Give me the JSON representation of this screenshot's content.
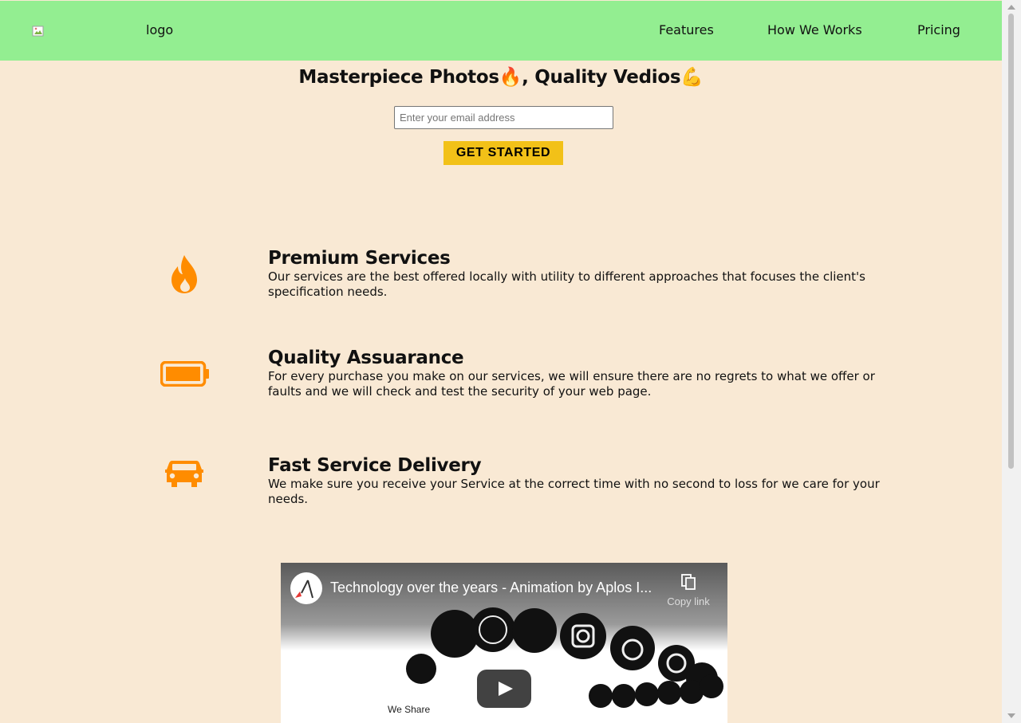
{
  "nav": {
    "logo_alt": "logo",
    "links": [
      "Features",
      "How We Works",
      "Pricing"
    ]
  },
  "hero": {
    "title": "Masterpiece Photos🔥, Quality Vedios💪",
    "email_placeholder": "Enter your email address",
    "cta_label": "GET STARTED"
  },
  "features": [
    {
      "icon": "fire-icon",
      "title": "Premium Services",
      "desc": "Our services are the best offered locally with utility to different approaches that focuses the client's specification needs."
    },
    {
      "icon": "battery-icon",
      "title": "Quality Assuarance",
      "desc": "For every purchase you make on our services, we will ensure there are no regrets to what we offer or faults and we will check and test the security of your web page."
    },
    {
      "icon": "car-icon",
      "title": "Fast Service Delivery",
      "desc": "We make sure you receive your Service at the correct time with no second to loss for we care for your needs."
    }
  ],
  "video": {
    "title": "Technology over the years - Animation by Aplos I...",
    "copy_link_label": "Copy link",
    "caption": "We Share"
  },
  "colors": {
    "nav_bg": "#93ee91",
    "page_bg": "#f9e9d4",
    "accent_orange": "#ff8c00",
    "cta_yellow": "#f2c118"
  }
}
